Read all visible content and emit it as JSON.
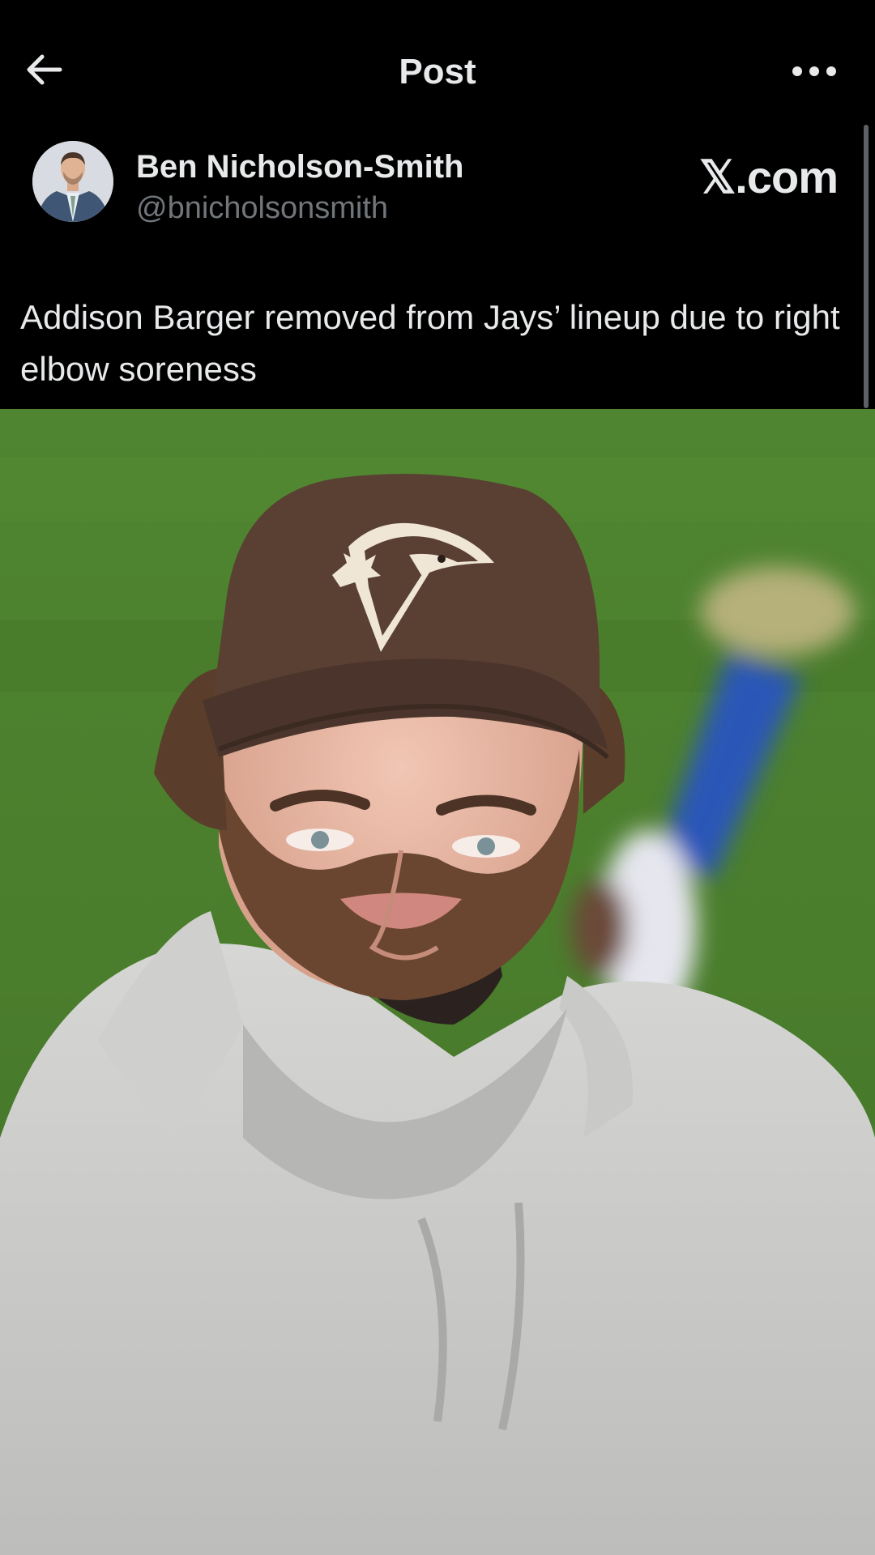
{
  "header": {
    "title": "Post",
    "back_icon": "arrow-left-icon",
    "more_icon": "more-horizontal-icon"
  },
  "author": {
    "name": "Ben Nicholson-Smith",
    "handle": "@bnicholsonsmith",
    "watermark": "𝕏.com"
  },
  "post": {
    "text": "Addison Barger removed from Jays’ lineup due to right elbow soreness"
  },
  "colors": {
    "background": "#000000",
    "text_primary": "#e7e9ea",
    "text_secondary": "#71767b",
    "field_green": "#4a7d2f"
  }
}
